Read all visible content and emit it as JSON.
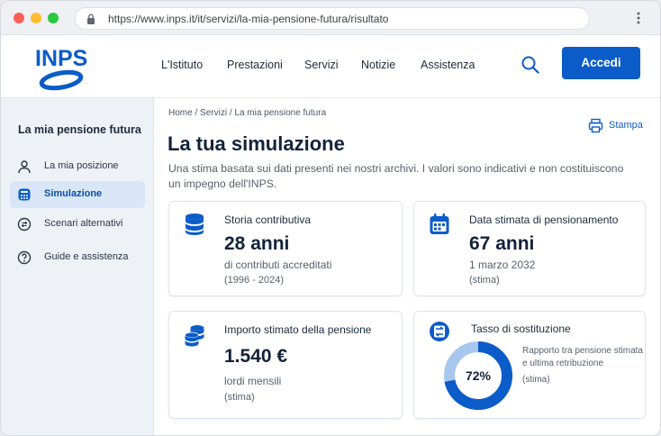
{
  "browser": {
    "url": "https://www.inps.it/it/servizi/la-mia-pensione-futura/risultato"
  },
  "header": {
    "logo_text": "INPS",
    "nav": [
      "L'Istituto",
      "Prestazioni",
      "Servizi",
      "Notizie",
      "Assistenza"
    ],
    "login_label": "Accedi"
  },
  "sidebar": {
    "title": "La mia pensione futura",
    "items": [
      {
        "label": "La mia posizione",
        "icon": "user-icon"
      },
      {
        "label": "Simulazione",
        "icon": "calculator-icon",
        "active": true
      },
      {
        "label": "Scenari alternativi",
        "icon": "scenario-icon"
      },
      {
        "label": "Guide e assistenza",
        "icon": "help-icon"
      }
    ]
  },
  "main": {
    "breadcrumb": [
      "Home",
      "Servizi",
      "La mia pensione futura"
    ],
    "breadcrumb_sep": "/",
    "print_label": "Stampa",
    "title": "La tua simulazione",
    "intro": "Una stima basata sui dati presenti nei nostri archivi. I valori sono indicativi e non costituiscono un impegno dell'INPS.",
    "cards": {
      "history": {
        "label": "Storia contributiva",
        "value": "28 anni",
        "sub1": "di contributi accreditati",
        "sub2": "(1996 - 2024)",
        "icon": "database-icon"
      },
      "retirement": {
        "label": "Data stimata di pensionamento",
        "value": "67 anni",
        "sub1": "1 marzo 2032",
        "sub2": "(stima)",
        "icon": "calendar-icon"
      },
      "amount": {
        "label": "Importo stimato della pensione",
        "value": "1.540 €",
        "sub1": "lordi mensili",
        "sub2": "(stima)",
        "icon": "coins-icon"
      },
      "rate": {
        "label": "Tasso di sostituzione",
        "value": "72%",
        "percent": 72,
        "desc": "Rapporto tra pensione stimata e ultima retribuzione",
        "note": "(stima)",
        "icon": "replacement-icon"
      }
    }
  },
  "colors": {
    "primary": "#0b5cc9",
    "donut_track": "#a8c7ee",
    "title": "#13223a"
  }
}
